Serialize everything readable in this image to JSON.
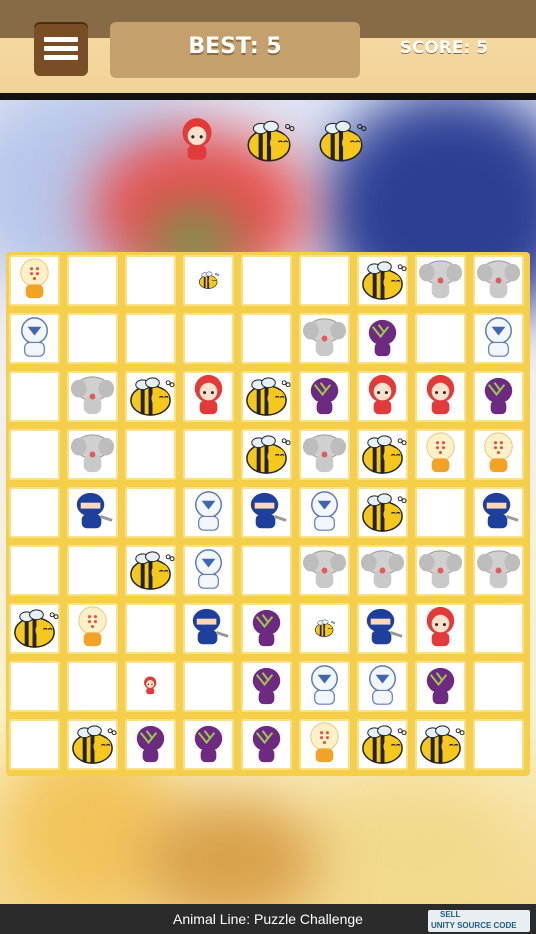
{
  "header": {
    "best_label": "BEST: 5",
    "score_label": "SCORE: 5"
  },
  "preview": {
    "pieces": [
      "girl-icon",
      "bee-icon",
      "bee-icon"
    ]
  },
  "board": {
    "rows": 9,
    "cols": 9,
    "cells": [
      [
        "baby",
        "",
        "",
        "bee-small",
        "",
        "",
        "bee",
        "elephant",
        "elephant"
      ],
      [
        "robot",
        "",
        "",
        "",
        "",
        "elephant",
        "eggplant",
        "",
        "robot"
      ],
      [
        "",
        "elephant",
        "bee",
        "girl",
        "bee",
        "eggplant",
        "girl",
        "girl",
        "eggplant"
      ],
      [
        "",
        "elephant",
        "",
        "",
        "bee",
        "elephant",
        "bee",
        "baby",
        "baby"
      ],
      [
        "",
        "ninja",
        "",
        "robot",
        "ninja",
        "robot",
        "bee",
        "",
        "ninja"
      ],
      [
        "",
        "",
        "bee",
        "robot",
        "",
        "elephant",
        "elephant",
        "elephant",
        "elephant"
      ],
      [
        "bee",
        "baby",
        "",
        "ninja",
        "eggplant",
        "bee-small",
        "ninja",
        "girl",
        ""
      ],
      [
        "",
        "",
        "girl-small",
        "",
        "eggplant",
        "robot",
        "robot",
        "eggplant",
        ""
      ],
      [
        "",
        "bee",
        "eggplant",
        "eggplant",
        "eggplant",
        "baby",
        "bee",
        "bee",
        ""
      ]
    ]
  },
  "footer": {
    "title": "Animal Line: Puzzle Challenge",
    "badge_line1": "SELL",
    "badge_line2": "UNITY SOURCE CODE"
  },
  "colors": {
    "header_top": "#876b47",
    "header_band": "#f4d89f",
    "best_panel": "#c4a06d",
    "menu_button": "#7a4e25",
    "board_border": "#f5cf4a",
    "footer": "#2b2b2b"
  }
}
